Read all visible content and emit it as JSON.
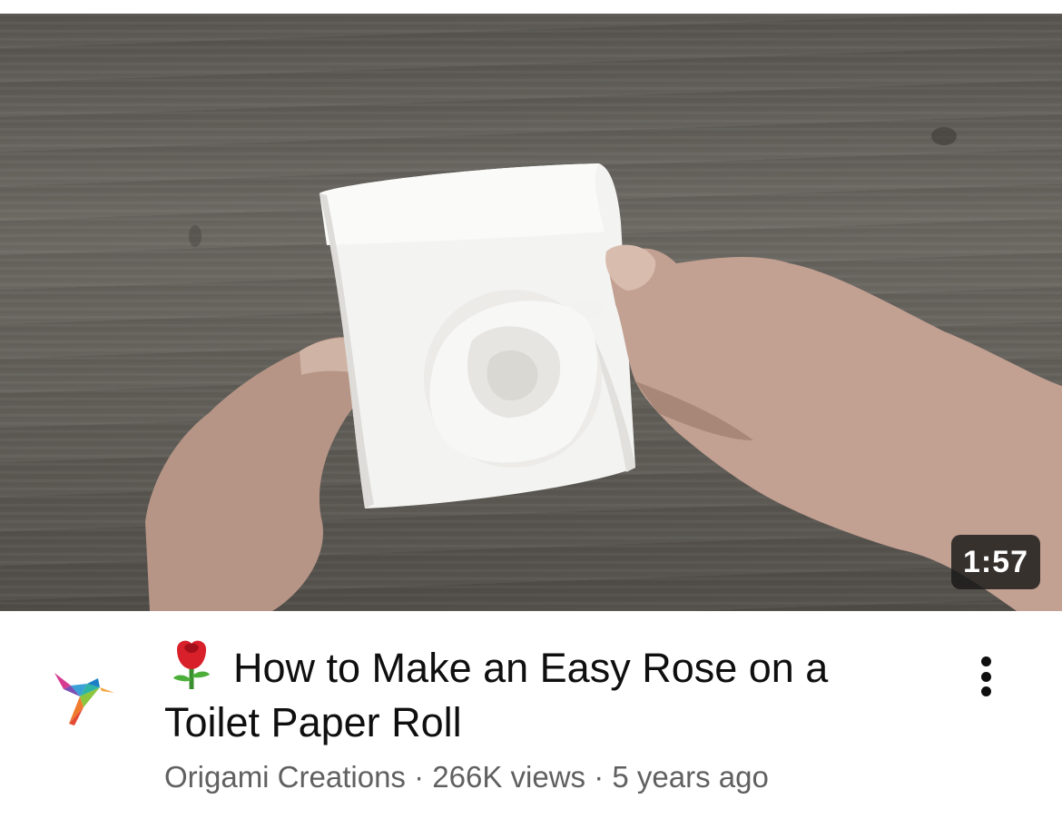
{
  "video": {
    "duration": "1:57",
    "title_emoji": "rose-emoji",
    "title": "How to Make an Easy Rose on a Toilet Paper Roll",
    "channel": "Origami Creations",
    "separator": "·",
    "views": "266K views",
    "age": "5 years ago"
  },
  "icons": {
    "avatar": "hummingbird-origami-logo",
    "more": "more-vertical-icon"
  }
}
